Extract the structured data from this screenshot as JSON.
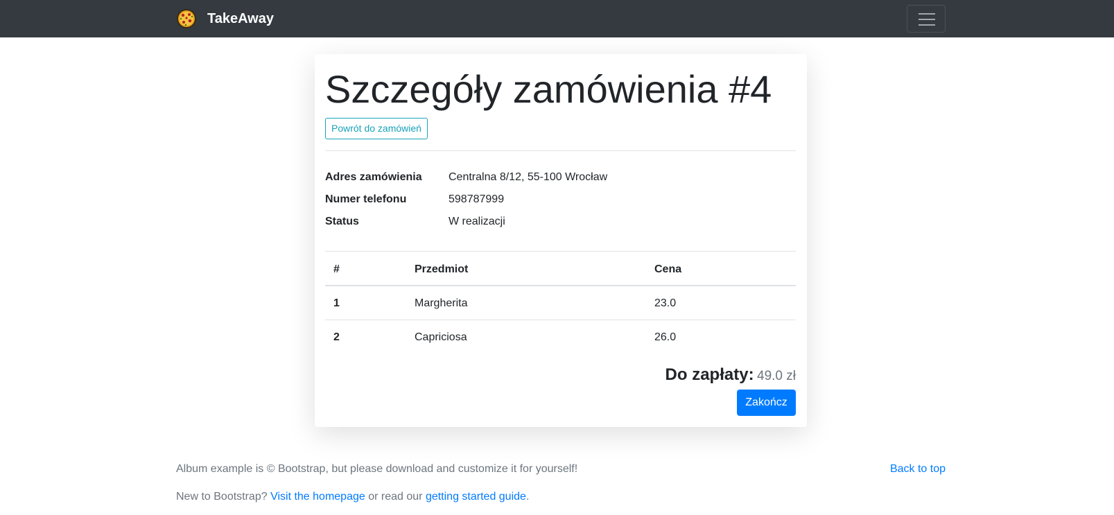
{
  "navbar": {
    "brand": "TakeAway",
    "logo_icon": "pizza-icon",
    "toggler_icon": "hamburger-menu-icon"
  },
  "order": {
    "title": "Szczegóły zamówienia #4",
    "back_button": "Powrót do zamówień",
    "info": [
      {
        "label": "Adres zamówienia",
        "value": "Centralna 8/12, 55-100 Wrocław"
      },
      {
        "label": "Numer telefonu",
        "value": "598787999"
      },
      {
        "label": "Status",
        "value": "W realizacji"
      }
    ],
    "table": {
      "headers": [
        "#",
        "Przedmiot",
        "Cena"
      ],
      "rows": [
        [
          "1",
          "Margherita",
          "23.0"
        ],
        [
          "2",
          "Capriciosa",
          "26.0"
        ]
      ]
    },
    "total_label": "Do zapłaty:",
    "total_value": "49.0 zł",
    "finish_button": "Zakończ"
  },
  "footer": {
    "line1": "Album example is © Bootstrap, but please download and customize it for yourself!",
    "back_to_top": "Back to top",
    "line2_prefix": "New to Bootstrap?",
    "homepage_link": "Visit the homepage",
    "line2_middle": "or read our",
    "guide_link": "getting started guide",
    "line2_suffix": "."
  },
  "colors": {
    "navbar_bg": "#343a40",
    "primary": "#007bff",
    "info": "#17a2b8",
    "muted": "#6c757d"
  }
}
